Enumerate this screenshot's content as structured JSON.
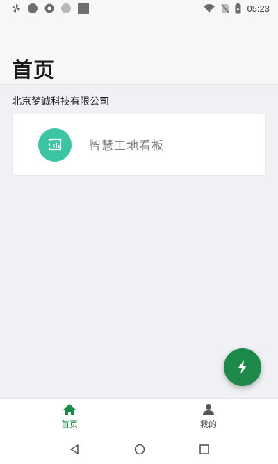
{
  "status_bar": {
    "time": "05:23",
    "left_icons": [
      "pinwheel-icon",
      "notification-badge-icon",
      "record-icon",
      "circle-icon",
      "square-icon"
    ],
    "right_icons": [
      "wifi-off-icon",
      "sim-off-icon",
      "battery-charging-icon"
    ]
  },
  "header": {
    "title": "首页"
  },
  "main": {
    "company_name": "北京梦诚科技有限公司",
    "apps": [
      {
        "label": "智慧工地看板",
        "icon": "dashboard-icon",
        "icon_color": "#3cc4a5"
      }
    ]
  },
  "fab": {
    "icon": "lightning-icon",
    "color": "#1e8a4a"
  },
  "bottom_nav": {
    "items": [
      {
        "label": "首页",
        "icon": "home-icon",
        "active": true
      },
      {
        "label": "我的",
        "icon": "person-icon",
        "active": false
      }
    ],
    "active_color": "#1e8a4a"
  },
  "system_nav": {
    "buttons": [
      "back",
      "home",
      "recents"
    ]
  }
}
